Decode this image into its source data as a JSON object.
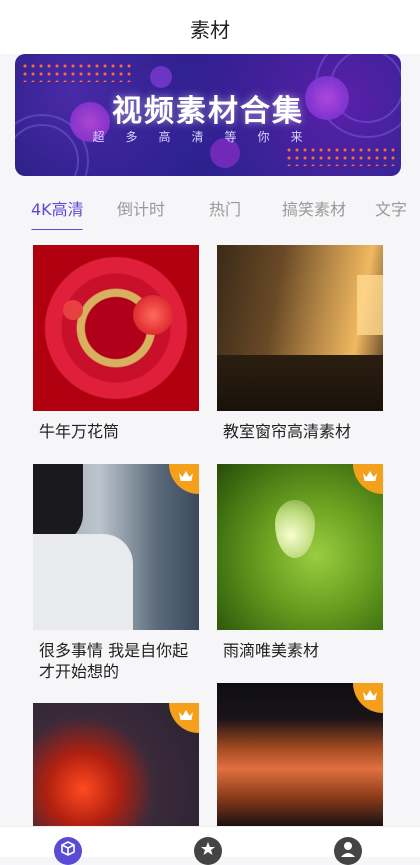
{
  "header": {
    "title": "素材"
  },
  "banner": {
    "title": "视频素材合集",
    "subtitle": "超多高清等你来"
  },
  "tabs": [
    {
      "label": "4K高清",
      "active": true
    },
    {
      "label": "倒计时",
      "active": false
    },
    {
      "label": "热门",
      "active": false
    },
    {
      "label": "搞笑素材",
      "active": false
    },
    {
      "label": "文字",
      "active": false
    }
  ],
  "cards": [
    {
      "label": "牛年万花筒",
      "premium": false
    },
    {
      "label": "教室窗帘高清素材",
      "premium": false
    },
    {
      "label": "很多事情 我是自你起 才开始想的",
      "premium": true
    },
    {
      "label": "雨滴唯美素材",
      "premium": true
    },
    {
      "label": "",
      "premium": true
    },
    {
      "label": "",
      "premium": true
    }
  ],
  "bottom_nav": [
    {
      "icon": "cube-icon",
      "active": true
    },
    {
      "icon": "star-icon",
      "active": false
    },
    {
      "icon": "user-icon",
      "active": false
    }
  ],
  "colors": {
    "accent": "#5a4bd6",
    "premium": "#f5a01a"
  }
}
